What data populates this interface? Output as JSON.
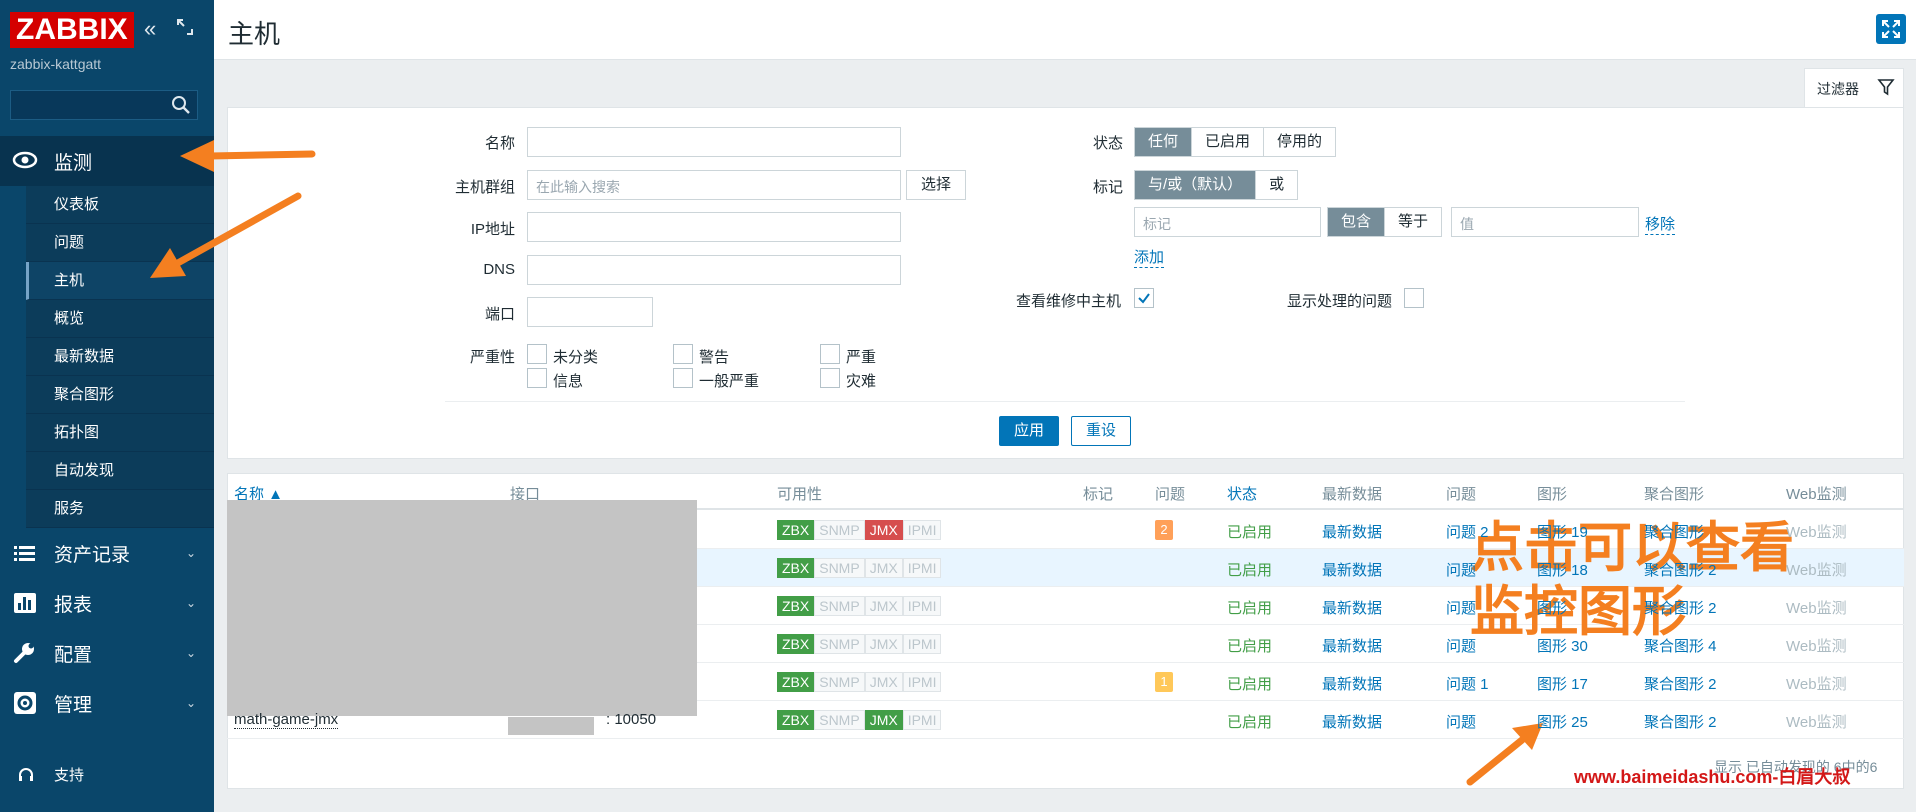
{
  "sidebar": {
    "logo": "ZABBIX",
    "server_name": "zabbix-kattgatt",
    "search_placeholder": "",
    "sections": {
      "monitor": "监测",
      "inventory": "资产记录",
      "reports": "报表",
      "config": "配置",
      "admin": "管理",
      "support": "支持"
    },
    "monitor_items": [
      "仪表板",
      "问题",
      "主机",
      "概览",
      "最新数据",
      "聚合图形",
      "拓扑图",
      "自动发现",
      "服务"
    ],
    "active_item": "主机"
  },
  "header": {
    "title": "主机"
  },
  "filter": {
    "tab_label": "过滤器",
    "name_label": "名称",
    "hostgroup_label": "主机群组",
    "hostgroup_placeholder": "在此输入搜索",
    "select_button": "选择",
    "ip_label": "IP地址",
    "dns_label": "DNS",
    "port_label": "端口",
    "severity_label": "严重性",
    "severities": [
      "未分类",
      "警告",
      "严重",
      "信息",
      "一般严重",
      "灾难"
    ],
    "status_label": "状态",
    "status_options": [
      "任何",
      "已启用",
      "停用的"
    ],
    "status_selected": "任何",
    "tags_label": "标记",
    "tag_ops": [
      "与/或（默认）",
      "或"
    ],
    "tag_placeholder": "标记",
    "tag_match": [
      "包含",
      "等于"
    ],
    "value_placeholder": "值",
    "remove_link": "移除",
    "add_link": "添加",
    "maintenance_label": "查看维修中主机",
    "maintenance_checked": true,
    "show_suppressed_label": "显示处理的问题",
    "show_suppressed_checked": false,
    "apply_button": "应用",
    "reset_button": "重设"
  },
  "table": {
    "columns": [
      "名称 ▲",
      "接口",
      "可用性",
      "标记",
      "问题",
      "状态",
      "最新数据",
      "问题",
      "图形",
      "聚合图形",
      "Web监测"
    ],
    "rows": [
      {
        "name": "",
        "iface": "",
        "avail": [
          "ZBX",
          "SNMP",
          "JMX",
          "IPMI"
        ],
        "avail_state": [
          "g",
          "n",
          "r",
          "n"
        ],
        "problems": "2",
        "problem_sev": "warn",
        "status": "已启用",
        "latest": "最新数据",
        "problems_link": "问题 2",
        "graphs": "图形 19",
        "screens": "聚合图形",
        "web": "Web监测"
      },
      {
        "name": "",
        "iface": "",
        "avail": [
          "ZBX",
          "SNMP",
          "JMX",
          "IPMI"
        ],
        "avail_state": [
          "g",
          "n",
          "n",
          "n"
        ],
        "problems": "",
        "problem_sev": "",
        "status": "已启用",
        "latest": "最新数据",
        "problems_link": "问题",
        "graphs": "图形 18",
        "screens": "聚合图形 2",
        "web": "Web监测"
      },
      {
        "name": "",
        "iface": "",
        "avail": [
          "ZBX",
          "SNMP",
          "JMX",
          "IPMI"
        ],
        "avail_state": [
          "g",
          "n",
          "n",
          "n"
        ],
        "problems": "",
        "problem_sev": "",
        "status": "已启用",
        "latest": "最新数据",
        "problems_link": "问题",
        "graphs": "图形",
        "screens": "聚合图形 2",
        "web": "Web监测"
      },
      {
        "name": "",
        "iface": "",
        "avail": [
          "ZBX",
          "SNMP",
          "JMX",
          "IPMI"
        ],
        "avail_state": [
          "g",
          "n",
          "n",
          "n"
        ],
        "problems": "",
        "problem_sev": "",
        "status": "已启用",
        "latest": "最新数据",
        "problems_link": "问题",
        "graphs": "图形 30",
        "screens": "聚合图形 4",
        "web": "Web监测"
      },
      {
        "name": "",
        "iface": "",
        "avail": [
          "ZBX",
          "SNMP",
          "JMX",
          "IPMI"
        ],
        "avail_state": [
          "g",
          "n",
          "n",
          "n"
        ],
        "problems": "1",
        "problem_sev": "avg",
        "status": "已启用",
        "latest": "最新数据",
        "problems_link": "问题 1",
        "graphs": "图形 17",
        "screens": "聚合图形 2",
        "web": "Web监测"
      },
      {
        "name": "math-game-jmx",
        "iface": ": 10050",
        "avail": [
          "ZBX",
          "SNMP",
          "JMX",
          "IPMI"
        ],
        "avail_state": [
          "g",
          "n",
          "g",
          "n"
        ],
        "problems": "",
        "problem_sev": "",
        "status": "已启用",
        "latest": "最新数据",
        "problems_link": "问题",
        "graphs": "图形 25",
        "screens": "聚合图形 2",
        "web": "Web监测"
      }
    ],
    "footer": "显示 已自动发现的 6中的6"
  },
  "annotation": {
    "line1": "点击可以查看",
    "line2": "监控图形"
  },
  "watermark": "www.baimeidashu.com-白眉大叔",
  "colors": {
    "sidebar": "#0a466a",
    "accent": "#0275b8",
    "arrow": "#f47f20",
    "logo": "#d40000"
  }
}
